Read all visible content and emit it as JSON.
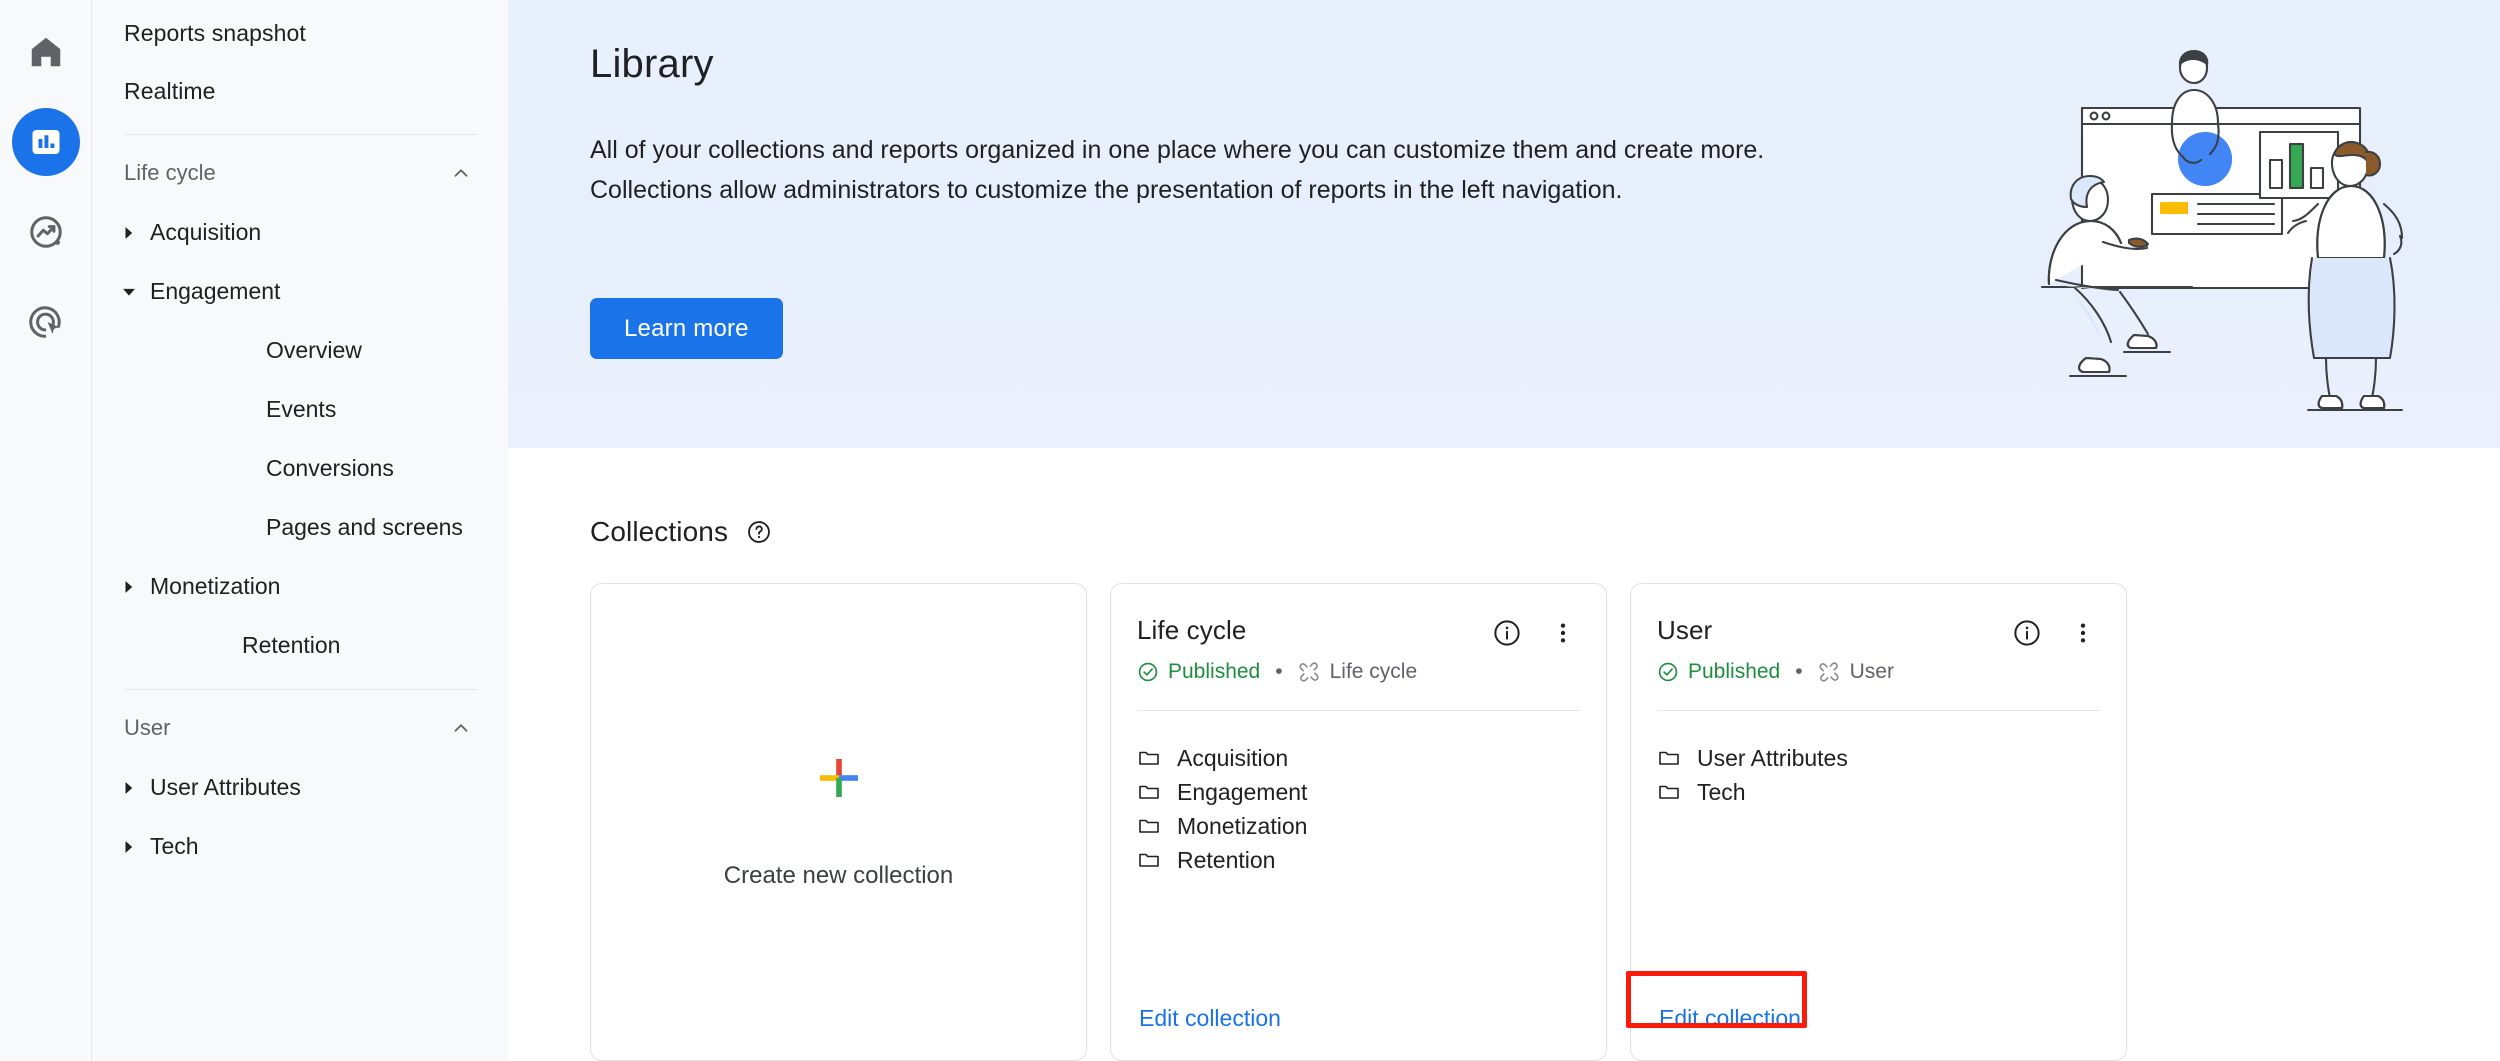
{
  "rail": {
    "items": [
      {
        "name": "home-icon",
        "label": "Home",
        "active": false
      },
      {
        "name": "reports-icon",
        "label": "Reports",
        "active": true
      },
      {
        "name": "explore-icon",
        "label": "Explore",
        "active": false
      },
      {
        "name": "advertising-icon",
        "label": "Advertising",
        "active": false
      }
    ]
  },
  "sidebar": {
    "top_items": [
      {
        "label": "Reports snapshot"
      },
      {
        "label": "Realtime"
      }
    ],
    "sections": [
      {
        "title": "Life cycle",
        "collapse_icon": "chevron-up-icon",
        "items": [
          {
            "label": "Acquisition",
            "arrow": "right",
            "level": 1
          },
          {
            "label": "Engagement",
            "arrow": "down",
            "level": 1
          },
          {
            "label": "Overview",
            "arrow": "none",
            "level": 2
          },
          {
            "label": "Events",
            "arrow": "none",
            "level": 2
          },
          {
            "label": "Conversions",
            "arrow": "none",
            "level": 2
          },
          {
            "label": "Pages and screens",
            "arrow": "none",
            "level": 2
          },
          {
            "label": "Monetization",
            "arrow": "right",
            "level": 1
          },
          {
            "label": "Retention",
            "arrow": "none",
            "level": 1
          }
        ]
      },
      {
        "title": "User",
        "collapse_icon": "chevron-up-icon",
        "items": [
          {
            "label": "User Attributes",
            "arrow": "right",
            "level": 1
          },
          {
            "label": "Tech",
            "arrow": "right",
            "level": 1
          }
        ]
      }
    ]
  },
  "hero": {
    "title": "Library",
    "description": "All of your collections and reports organized in one place where you can customize them and create more. Collections allow administrators to customize the presentation of reports in the left navigation.",
    "learn_more_label": "Learn more",
    "illustration_name": "people-with-dashboard-illustration",
    "background_color": "#e9f0fd",
    "button_color": "#1a73e8"
  },
  "collections": {
    "title": "Collections",
    "help_icon": "help-circle-icon",
    "create_card": {
      "label": "Create new collection",
      "icon": "google-plus-icon",
      "plus_colors": {
        "top": "#ea4335",
        "left": "#fbbc04",
        "right": "#4285f4",
        "bottom": "#34a853"
      }
    },
    "status_color": "#1e8e3e",
    "link_color": "#1a73e8",
    "cards": [
      {
        "title": "Life cycle",
        "status": "Published",
        "separator": "•",
        "link_label": "Life cycle",
        "info_icon": "info-circle-icon",
        "more_icon": "more-vertical-icon",
        "link_icon": "topic-link-icon",
        "items": [
          "Acquisition",
          "Engagement",
          "Monetization",
          "Retention"
        ],
        "edit_label": "Edit collection",
        "highlighted": true
      },
      {
        "title": "User",
        "status": "Published",
        "separator": "•",
        "link_label": "User",
        "info_icon": "info-circle-icon",
        "more_icon": "more-vertical-icon",
        "link_icon": "topic-link-icon",
        "items": [
          "User Attributes",
          "Tech"
        ],
        "edit_label": "Edit collection",
        "highlighted": false
      }
    ]
  },
  "annotation": {
    "highlight_color": "#fc1b0a",
    "target": "Edit collection"
  }
}
